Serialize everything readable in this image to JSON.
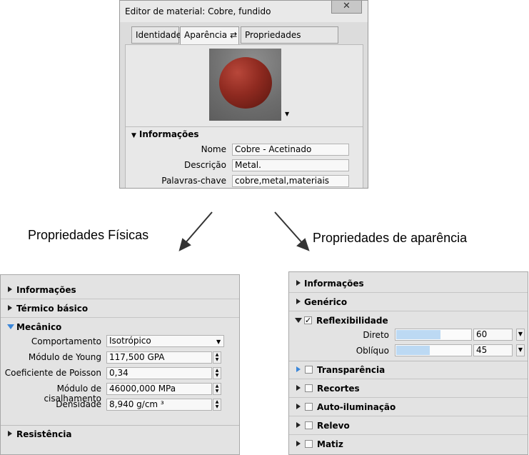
{
  "editor": {
    "title": "Editor de material: Cobre, fundido",
    "close_icon": "close-icon",
    "tabs": [
      {
        "label": "Identidade"
      },
      {
        "label": "Aparência"
      },
      {
        "label": "Propriedades físicas"
      }
    ],
    "swap_icon": "⇄",
    "info_header": "Informações",
    "fields": {
      "name_label": "Nome",
      "name_value": "Cobre - Acetinado",
      "desc_label": "Descrição",
      "desc_value": "Metal.",
      "kw_label": "Palavras-chave",
      "kw_value": "cobre,metal,materiais"
    }
  },
  "captions": {
    "physical": "Propriedades Físicas",
    "appearance": "Propriedades de aparência"
  },
  "physical_panel": {
    "informacoes": "Informações",
    "termico": "Térmico básico",
    "mecanico": "Mecânico",
    "resistencia": "Resistência",
    "props": {
      "comportamento_label": "Comportamento",
      "comportamento_value": "Isotrópico",
      "young_label": "Módulo de Young",
      "young_value": "117,500 GPA",
      "poisson_label": "Coeficiente de Poisson",
      "poisson_value": "0,34",
      "shear_label": "Módulo de cisalhamento",
      "shear_value": "46000,000 MPa",
      "density_label": "Densidade",
      "density_value": "8,940 g/cm ³"
    }
  },
  "appearance_panel": {
    "informacoes": "Informações",
    "generico": "Genérico",
    "reflexibilidade": "Reflexibilidade",
    "direto_label": "Direto",
    "direto_value": "60",
    "direto_fraction": 0.6,
    "obliquo_label": "Oblíquo",
    "obliquo_value": "45",
    "obliquo_fraction": 0.45,
    "transparencia": "Transparência",
    "recortes": "Recortes",
    "auto": "Auto-iluminação",
    "relevo": "Relevo",
    "matiz": "Matiz"
  },
  "colors": {
    "accent": "#3a86d9",
    "slider_fill": "#bcd9f3",
    "copper": "#8f2a20"
  }
}
